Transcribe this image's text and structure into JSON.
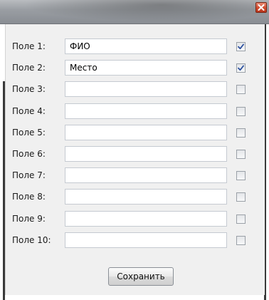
{
  "window": {
    "close_icon": "close-icon"
  },
  "fields": [
    {
      "label": "Поле 1:",
      "value": "ФИО",
      "checked": true
    },
    {
      "label": "Поле 2:",
      "value": "Место",
      "checked": true
    },
    {
      "label": "Поле 3:",
      "value": "",
      "checked": false
    },
    {
      "label": "Поле 4:",
      "value": "",
      "checked": false
    },
    {
      "label": "Поле 5:",
      "value": "",
      "checked": false
    },
    {
      "label": "Поле 6:",
      "value": "",
      "checked": false
    },
    {
      "label": "Поле 7:",
      "value": "",
      "checked": false
    },
    {
      "label": "Поле 8:",
      "value": "",
      "checked": false
    },
    {
      "label": "Поле 9:",
      "value": "",
      "checked": false
    },
    {
      "label": "Поле 10:",
      "value": "",
      "checked": false
    }
  ],
  "actions": {
    "save_label": "Сохранить"
  },
  "colors": {
    "close_button": "#cf4b2f",
    "checkmark": "#2b4f9e"
  }
}
